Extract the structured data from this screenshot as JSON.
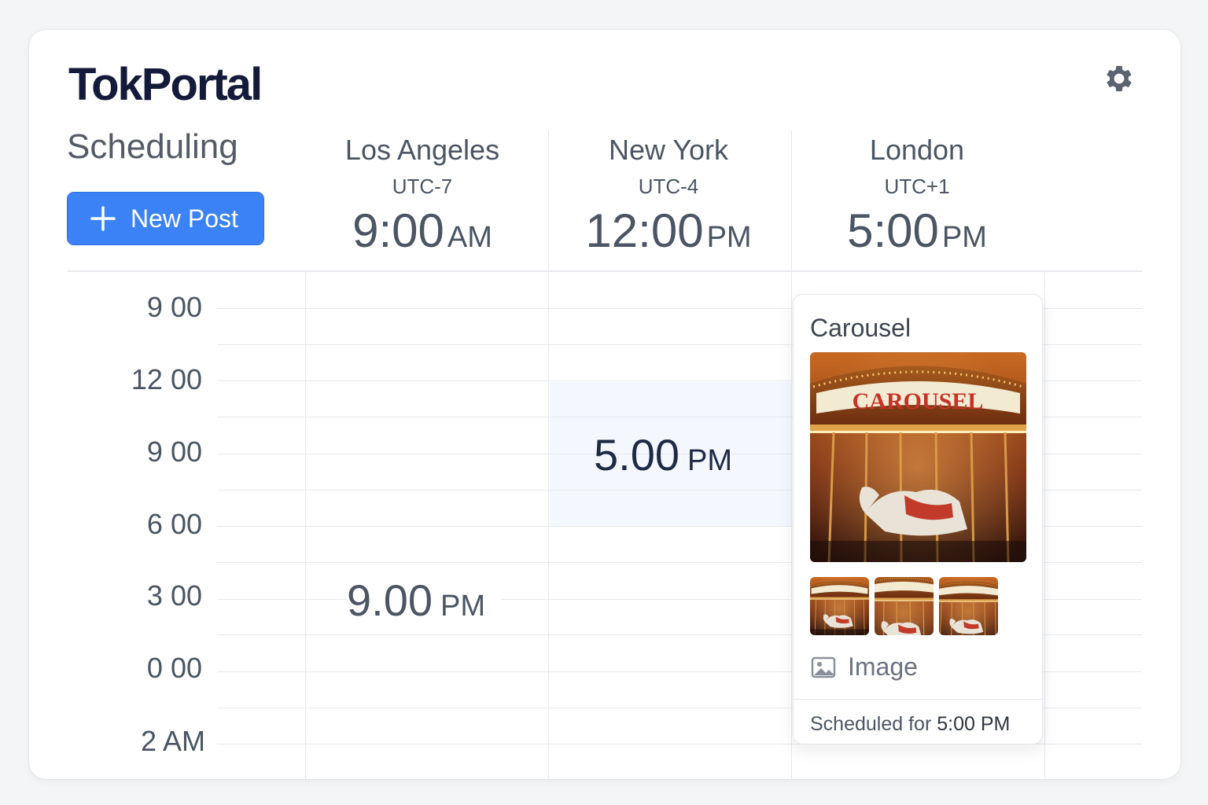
{
  "app": {
    "title": "TokPortal"
  },
  "page": {
    "section_title": "Scheduling",
    "new_post_label": "New Post"
  },
  "timezones": [
    {
      "city": "Los Angeles",
      "utc": "UTC-7",
      "time": "9:00",
      "meridiem": "AM"
    },
    {
      "city": "New York",
      "utc": "UTC-4",
      "time": "12:00",
      "meridiem": "PM"
    },
    {
      "city": "London",
      "utc": "UTC+1",
      "time": "5:00",
      "meridiem": "PM"
    }
  ],
  "row_labels": [
    "9 00",
    "12 00",
    "9 00",
    "6 00",
    "3 00",
    "0 00",
    "2 AM"
  ],
  "slots": [
    {
      "column": "New York",
      "time": "5.00",
      "meridiem": "PM",
      "highlighted": true
    },
    {
      "column": "Los Angeles",
      "time": "9.00",
      "meridiem": "PM",
      "highlighted": false
    }
  ],
  "popup": {
    "title": "Carousel",
    "image_text": "CAROUSEL",
    "thumbnail_count": 3,
    "media_type": "Image",
    "scheduled_prefix": "Scheduled for",
    "scheduled_time": "5:00 PM"
  },
  "colors": {
    "brand": "#141b3a",
    "primary_button": "#3b82f6",
    "highlight_cell": "#f4f8fe",
    "text": "#4b5563"
  },
  "icons": {
    "settings": "gear-icon",
    "new_post": "plus-icon",
    "media": "image-icon"
  }
}
